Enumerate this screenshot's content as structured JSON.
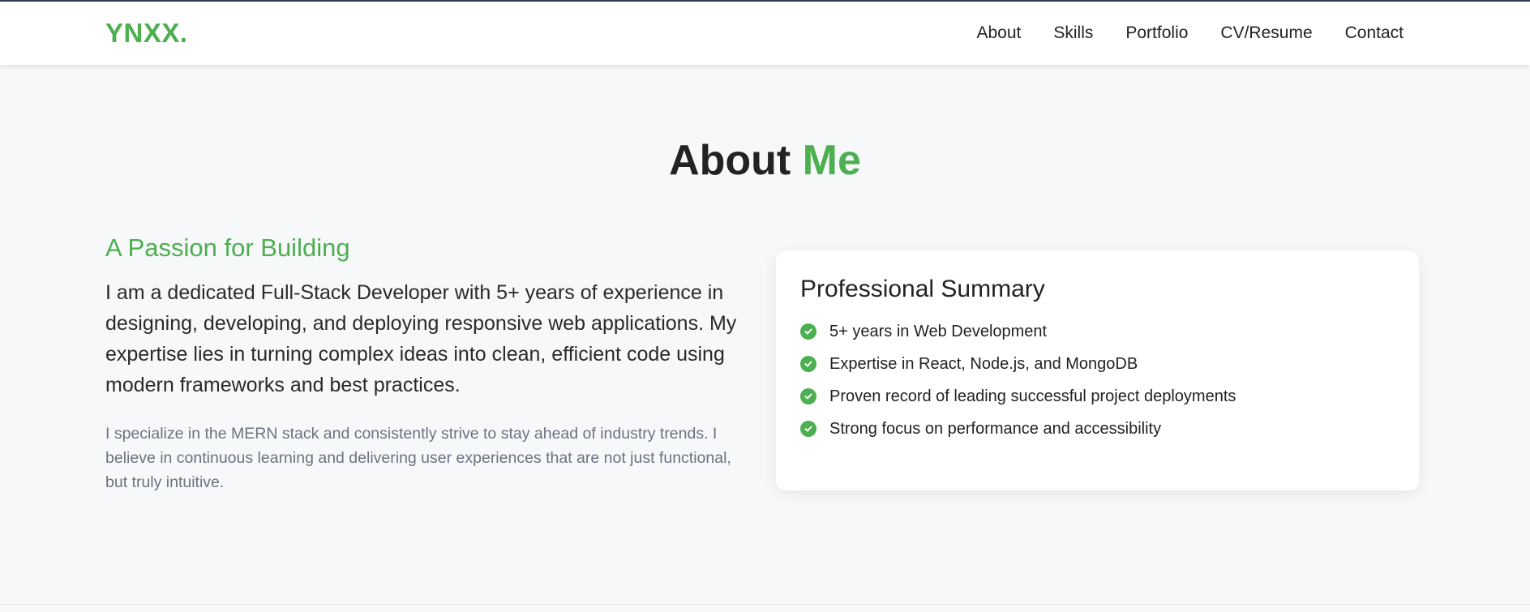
{
  "nav": {
    "logo": "YNXX.",
    "links": [
      {
        "label": "About"
      },
      {
        "label": "Skills"
      },
      {
        "label": "Portfolio"
      },
      {
        "label": "CV/Resume"
      },
      {
        "label": "Contact"
      }
    ]
  },
  "about": {
    "title_main": "About ",
    "title_accent": "Me",
    "heading": "A Passion for Building",
    "lead": "I am a dedicated Full-Stack Developer with 5+ years of experience in designing, developing, and deploying responsive web applications. My expertise lies in turning complex ideas into clean, efficient code using modern frameworks and best practices.",
    "detail": "I specialize in the MERN stack and consistently strive to stay ahead of industry trends. I believe in continuous learning and delivering user experiences that are not just functional, but truly intuitive."
  },
  "summary": {
    "title": "Professional Summary",
    "items": [
      {
        "text": "5+ years in Web Development",
        "icon": "check-circle-icon"
      },
      {
        "text": "Expertise in React, Node.js, and MongoDB",
        "icon": "check-circle-icon"
      },
      {
        "text": "Proven record of leading successful project deployments",
        "icon": "check-circle-icon"
      },
      {
        "text": "Strong focus on performance and accessibility",
        "icon": "check-circle-icon"
      }
    ]
  },
  "colors": {
    "accent": "#4caf50",
    "text": "#222222",
    "muted": "#6b7280",
    "background": "#f7f8fa"
  }
}
